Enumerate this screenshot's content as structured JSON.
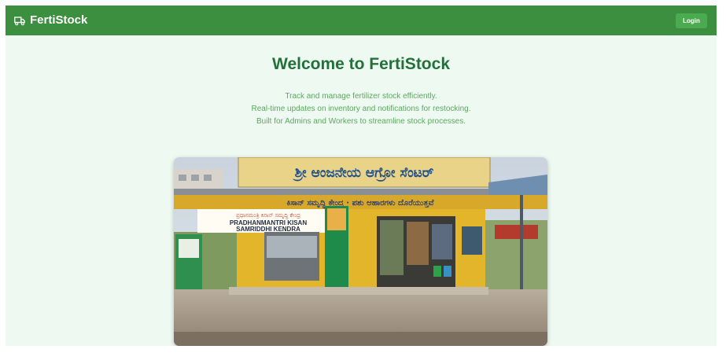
{
  "app": {
    "brand_icon": "truck-icon",
    "brand_name": "FertiStock",
    "login_label": "Login"
  },
  "hero": {
    "title": "Welcome to FertiStock",
    "taglines": [
      "Track and manage fertilizer stock efficiently.",
      "Real-time updates on inventory and notifications for restocking.",
      "Built for Admins and Workers to streamline stock processes."
    ]
  },
  "photo": {
    "signboard_text": "ಶ್ರೀ ಆಂಜನೇಯ ಆಗ್ರೋ ಸೆಂಟರ್",
    "banner_kannada": "ಪ್ರಧಾನಮಂತ್ರಿ ಕಿಸಾನ್ ಸಮೃದ್ಧಿ ಕೇಂದ್ರ",
    "banner_line1": "PRADHANMANTRI KISAN",
    "banner_line2": "SAMRIDDHI KENDRA"
  },
  "colors": {
    "navbar": "#3b8f3f",
    "login_button": "#4cab51",
    "page_background": "#eefaf1",
    "title": "#23713a",
    "tagline": "#5aa85f"
  }
}
